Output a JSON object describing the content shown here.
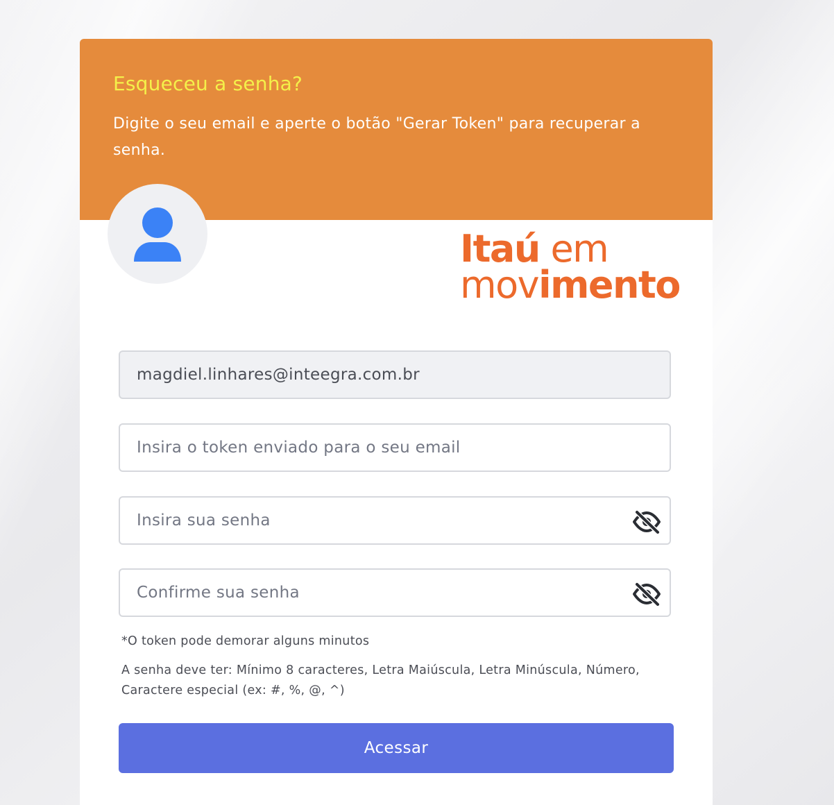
{
  "header": {
    "title": "Esqueceu a senha?",
    "subtitle": "Digite o seu email e aperte o botão \"Gerar Token\" para recuperar a senha."
  },
  "logo": {
    "line1_bold": "Itaú",
    "line1_light": " em",
    "line2_light": "mov",
    "line2_bold": "imento"
  },
  "form": {
    "email_value": "magdiel.linhares@inteegra.com.br",
    "token_placeholder": "Insira o token enviado para o seu email",
    "password_placeholder": "Insira sua senha",
    "confirm_placeholder": "Confirme sua senha",
    "token_note": "*O token pode demorar alguns minutos",
    "password_rules": "A senha deve ter: Mínimo 8 caracteres, Letra Maiúscula, Letra Minúscula, Número, Caractere especial (ex: #, %, @, ^)",
    "submit_label": "Acessar"
  },
  "icons": {
    "avatar": "user-icon",
    "password_toggle": "eye-off-icon",
    "confirm_toggle": "eye-off-icon"
  },
  "colors": {
    "header_bg": "#e58b3c",
    "title": "#f4f04a",
    "logo": "#ec6a2c",
    "avatar_icon": "#3b82f6",
    "button": "#5b6fe0"
  }
}
